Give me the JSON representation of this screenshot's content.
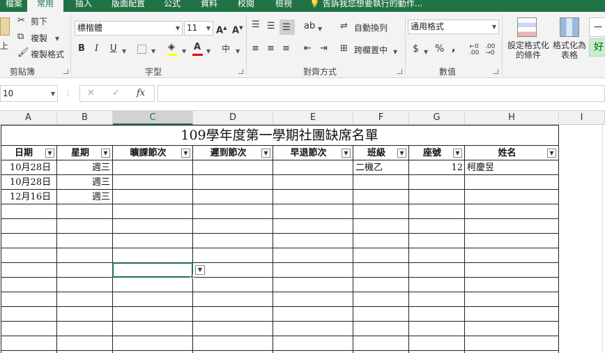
{
  "ribbon_tabs": [
    "檔案",
    "常用",
    "插入",
    "版面配置",
    "公式",
    "資料",
    "校閱",
    "檢視"
  ],
  "tell_me": "告訴我您想要執行的動作...",
  "clipboard": {
    "paste_label": "上",
    "cut_label": "剪下",
    "copy_label": "複製",
    "format_painter_label": "複製格式",
    "group_label": "剪貼簿"
  },
  "font": {
    "name": "標楷體",
    "size": "11",
    "group_label": "字型",
    "bold": "B",
    "italic": "I",
    "underline": "U",
    "font_color_letter": "A",
    "phonetic": "中",
    "increase_size": "A",
    "decrease_size": "A"
  },
  "alignment": {
    "wrap_text": "自動換列",
    "merge_center": "跨欄置中",
    "group_label": "對齊方式"
  },
  "number": {
    "format": "通用格式",
    "group_label": "數值",
    "currency": "$",
    "percent": "%",
    "comma": ",",
    "inc_decimal": ".00",
    "dec_decimal": ".00"
  },
  "styles": {
    "conditional_formatting": "設定格式化的條件",
    "format_as_table": "格式化為表格",
    "style_normal": "一般",
    "style_good": "好"
  },
  "formula_bar": {
    "name_box": "10",
    "cancel": "✕",
    "enter": "✓",
    "fx": "fx",
    "content": ""
  },
  "columns": [
    "A",
    "B",
    "C",
    "D",
    "E",
    "F",
    "G",
    "H",
    "I"
  ],
  "sheet": {
    "title": "109學年度第一學期社團缺席名單",
    "headers": [
      "日期",
      "星期",
      "曠課節次",
      "遲到節次",
      "早退節次",
      "班級",
      "座號",
      "姓名"
    ],
    "rows": [
      [
        "10月28日",
        "週三",
        "",
        "",
        "",
        "二機乙",
        "12",
        "柯慶昱"
      ],
      [
        "10月28日",
        "週三",
        "",
        "",
        "",
        "",
        "",
        ""
      ],
      [
        "12月16日",
        "週三",
        "",
        "",
        "",
        "",
        "",
        ""
      ]
    ]
  },
  "colors": {
    "accent": "#217346",
    "font_color_bar": "#e00000",
    "highlight_bar": "#ffff00"
  }
}
